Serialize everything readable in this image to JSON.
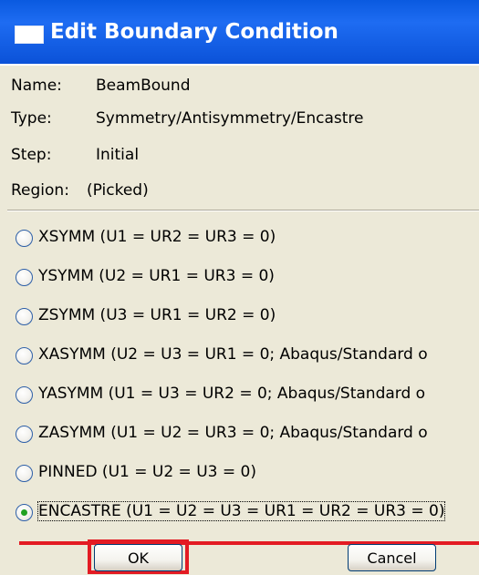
{
  "dialog": {
    "title": "Edit Boundary Condition"
  },
  "info": {
    "name_label": "Name:",
    "name_value": "BeamBound",
    "type_label": "Type:",
    "type_value": "Symmetry/Antisymmetry/Encastre",
    "step_label": "Step:",
    "step_value": "Initial",
    "region_label": "Region:",
    "region_value": "(Picked)"
  },
  "options": [
    {
      "label": "XSYMM (U1 = UR2 = UR3 = 0)",
      "selected": false
    },
    {
      "label": "YSYMM (U2 = UR1 = UR3 = 0)",
      "selected": false
    },
    {
      "label": "ZSYMM (U3 = UR1 = UR2 = 0)",
      "selected": false
    },
    {
      "label": "XASYMM (U2 = U3 = UR1 = 0; Abaqus/Standard o",
      "selected": false
    },
    {
      "label": "YASYMM (U1 = U3 = UR2 = 0; Abaqus/Standard o",
      "selected": false
    },
    {
      "label": "ZASYMM (U1 = U2 = UR3 = 0; Abaqus/Standard o",
      "selected": false
    },
    {
      "label": "PINNED (U1 = U2 = U3 = 0)",
      "selected": false
    },
    {
      "label": "ENCASTRE (U1 = U2 = U3 = UR1 = UR2 = UR3 = 0)",
      "selected": true
    }
  ],
  "buttons": {
    "ok_label": "OK",
    "cancel_label": "Cancel"
  },
  "colors": {
    "titlebar": "#0b52d8",
    "dialog_background": "#ece9d8",
    "highlight": "#e31b23",
    "radio_selected": "#21a121"
  }
}
